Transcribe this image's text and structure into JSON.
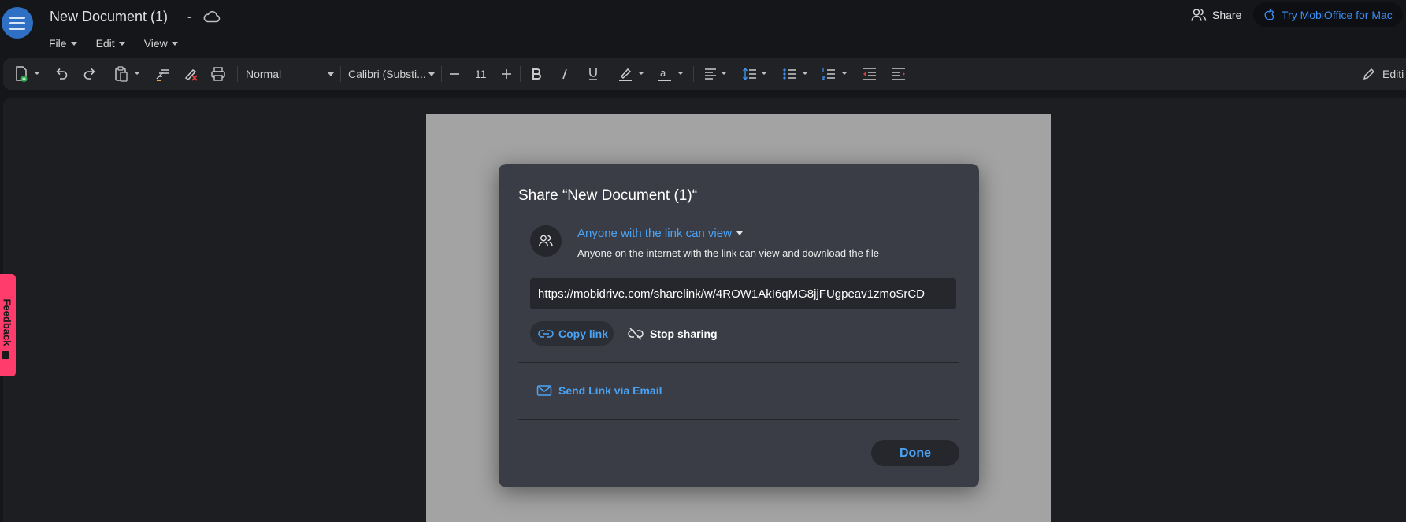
{
  "app": {
    "document_title": "New Document (1)",
    "title_separator": "-"
  },
  "menu": {
    "items": [
      {
        "label": "File"
      },
      {
        "label": "Edit"
      },
      {
        "label": "View"
      }
    ]
  },
  "header_actions": {
    "share_label": "Share",
    "try_mac_label": "Try MobiOffice for Mac"
  },
  "toolbar": {
    "paragraph_style": "Normal",
    "font_family": "Calibri (Substi...",
    "font_size": "11",
    "editing_label": "Editi"
  },
  "feedback": {
    "label": "Feedback"
  },
  "share_dialog": {
    "title": "Share “New Document (1)“",
    "permission_label": "Anyone with the link can view",
    "permission_description": "Anyone on the internet with the link can view and download the file",
    "link_url": "https://mobidrive.com/sharelink/w/4ROW1AkI6qMG8jjFUgpeav1zmoSrCD",
    "copy_link_label": "Copy link",
    "stop_sharing_label": "Stop sharing",
    "send_email_label": "Send Link via Email",
    "done_label": "Done"
  },
  "colors": {
    "accent_blue": "#4aa3f5",
    "menu_button_blue": "#2f6fc4",
    "feedback_pink": "#ff3c6b",
    "dialog_bg": "#3a3d45"
  },
  "icons": {
    "menu": "hamburger-icon",
    "cloud": "cloud-icon",
    "share": "people-icon",
    "mac": "apple-icon",
    "permission": "people-icon",
    "copy": "link-icon",
    "stop": "link-off-icon",
    "email": "envelope-icon"
  }
}
